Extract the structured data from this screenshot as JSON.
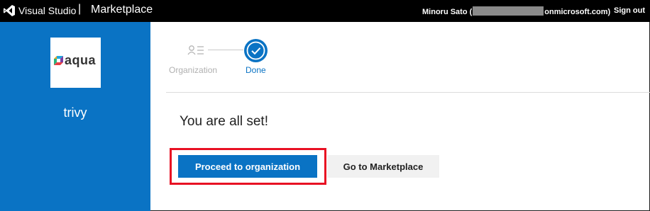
{
  "header": {
    "brand": "Visual Studio",
    "separator": "|",
    "section": "Marketplace",
    "user_prefix": "Minoru Sato (",
    "user_suffix": "onmicrosoft.com)",
    "sign_out": "Sign out"
  },
  "sidebar": {
    "logo_text": "aqua",
    "extension_name": "trivy"
  },
  "stepper": {
    "steps": [
      {
        "label": "Organization",
        "icon": "organization-icon",
        "state": "completed-inactive"
      },
      {
        "label": "Done",
        "icon": "checkmark-icon",
        "state": "current"
      }
    ]
  },
  "main": {
    "headline": "You are all set!",
    "primary_button": "Proceed to organization",
    "secondary_button": "Go to Marketplace"
  },
  "colors": {
    "topbar": "#000000",
    "accent": "#0a73c4",
    "highlight": "#e81123",
    "secondary_button": "#f1f1f1"
  }
}
